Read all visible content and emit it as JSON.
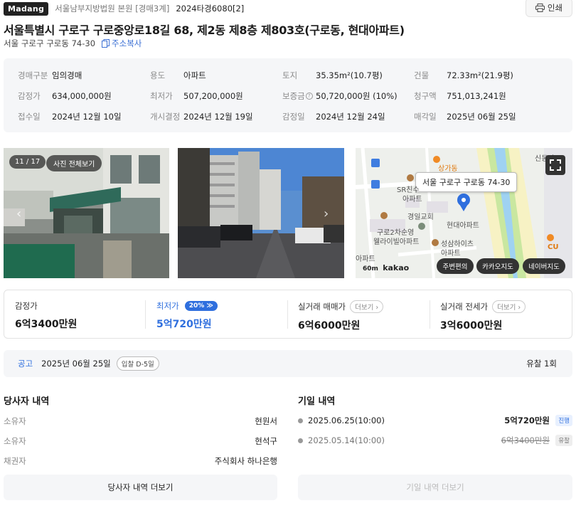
{
  "header": {
    "brand": "Madang",
    "court": "서울남부지방법원 본원 [경매3계]",
    "case_no": "2024타경6080[2]",
    "print_label": "인쇄"
  },
  "property": {
    "title": "서울특별시 구로구 구로중앙로18길 68, 제2동 제8층 제803호(구로동, 현대아파트)",
    "sub_address": "서울 구로구 구로동 74-30",
    "copy_label": "주소복사"
  },
  "info": [
    {
      "label": "경매구분",
      "value": "임의경매"
    },
    {
      "label": "용도",
      "value": "아파트"
    },
    {
      "label": "토지",
      "value": "35.35m²(10.7평)"
    },
    {
      "label": "건물",
      "value": "72.33m²(21.9평)"
    },
    {
      "label": "감정가",
      "value": "634,000,000원"
    },
    {
      "label": "최저가",
      "value": "507,200,000원"
    },
    {
      "label": "보증금",
      "value": "50,720,000원 (10%)"
    },
    {
      "label": "청구액",
      "value": "751,013,241원"
    },
    {
      "label": "접수일",
      "value": "2024년 12월 10일"
    },
    {
      "label": "개시결정",
      "value": "2024년 12월 19일"
    },
    {
      "label": "감정일",
      "value": "2024년 12월 24일"
    },
    {
      "label": "매각일",
      "value": "2025년 06월 25일"
    }
  ],
  "gallery": {
    "counter": "11 / 17",
    "view_all": "사진 전체보기"
  },
  "map": {
    "pin_label": "서울 구로구 구로동 74-30",
    "places": [
      "상가동",
      "SR친수",
      "아파트",
      "경일교회",
      "구로2차순영",
      "웰라이빌아파트",
      "현대아파트",
      "성삼하이츠",
      "아파트",
      "아파트",
      "신동아",
      "CU"
    ],
    "scale": "60m",
    "provider": "kakao",
    "buttons": [
      "주변편의",
      "카카오지도",
      "네이버지도"
    ]
  },
  "prices": {
    "appraisal_label": "감정가",
    "appraisal_value": "6억3400만원",
    "min_label": "최저가",
    "min_pct": "20%",
    "min_value": "5억720만원",
    "sale_label": "실거래 매매가",
    "sale_value": "6억6000만원",
    "jeonse_label": "실거래 전세가",
    "jeonse_value": "3억6000만원",
    "more_label": "더보기"
  },
  "notice": {
    "label": "공고",
    "date": "2025년 06월 25일",
    "dday": "입찰 D-5일",
    "result": "유찰 1회"
  },
  "parties": {
    "title": "당사자 내역",
    "rows": [
      {
        "role": "소유자",
        "name": "현원서"
      },
      {
        "role": "소유자",
        "name": "현석구"
      },
      {
        "role": "채권자",
        "name": "주식회사 하나은행"
      }
    ],
    "more_button": "당사자 내역 더보기"
  },
  "history": {
    "title": "기일 내역",
    "rows": [
      {
        "date": "2025.06.25(10:00)",
        "amount": "5억720만원",
        "status": "진행"
      },
      {
        "date": "2025.05.14(10:00)",
        "amount": "6억3400만원",
        "status": "유찰"
      }
    ],
    "more_button": "기일 내역 더보기"
  },
  "colors": {
    "accent": "#2f6fde",
    "panel_bg": "#f5f6f8"
  }
}
